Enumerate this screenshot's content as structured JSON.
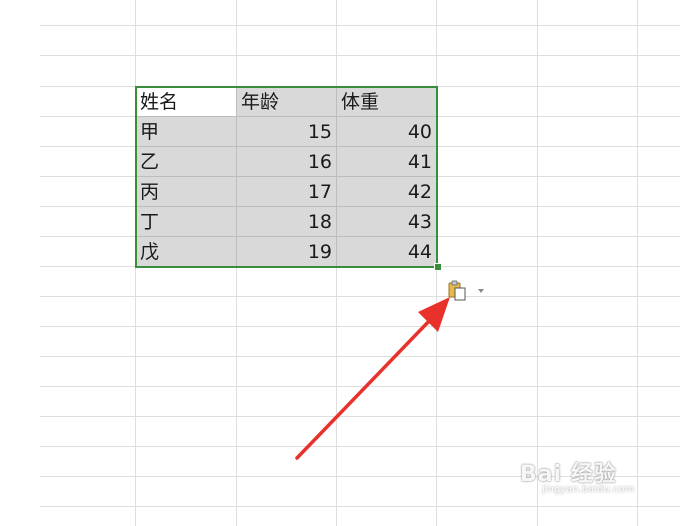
{
  "table": {
    "headers": [
      "姓名",
      "年龄",
      "体重"
    ],
    "rows": [
      [
        "甲",
        "15",
        "40"
      ],
      [
        "乙",
        "16",
        "41"
      ],
      [
        "丙",
        "17",
        "42"
      ],
      [
        "丁",
        "18",
        "43"
      ],
      [
        "戊",
        "19",
        "44"
      ]
    ]
  },
  "colors": {
    "selection_border": "#3a8d3a",
    "cell_fill": "#d9d9d9",
    "arrow": "#e8312a"
  },
  "icons": {
    "paste_options": "clipboard-icon",
    "dropdown": "triangle-down-icon"
  },
  "watermark": {
    "text": "Bai 经验",
    "sub": "jingyan.baidu.com"
  }
}
